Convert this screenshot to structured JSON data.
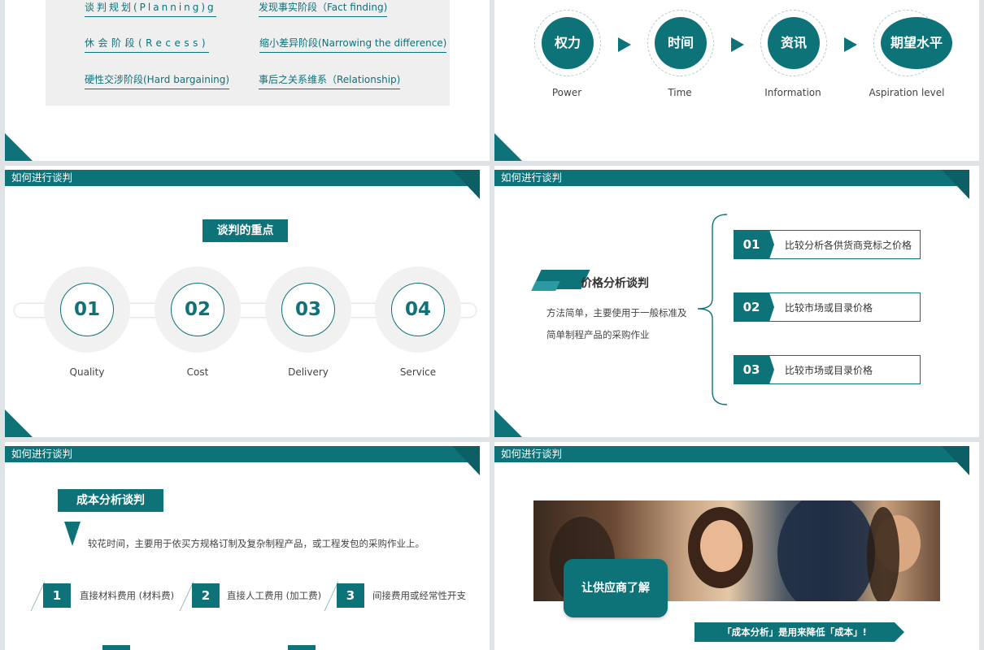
{
  "colors": {
    "accent": "#0e7279",
    "accent_dark": "#0d5f66"
  },
  "section_title": "如何进行谈判",
  "slide1": {
    "items": [
      "谈判规划(Planning)g",
      "发现事实阶段（Fact finding)",
      "休会阶段(Recess)",
      "缩小差异阶段(Narrowing the difference)",
      "硬性交涉阶段(Hard bargaining)",
      "事后之关系维系（Relationship)"
    ]
  },
  "slide2": {
    "factors": [
      {
        "cn": "权力",
        "en": "Power"
      },
      {
        "cn": "时间",
        "en": "Time"
      },
      {
        "cn": "资讯",
        "en": "Information"
      },
      {
        "cn": "期望水平",
        "en": "Aspiration level"
      }
    ]
  },
  "slide3": {
    "title": "谈判的重点",
    "points": [
      {
        "num": "01",
        "label": "Quality"
      },
      {
        "num": "02",
        "label": "Cost"
      },
      {
        "num": "03",
        "label": "Delivery"
      },
      {
        "num": "04",
        "label": "Service"
      }
    ]
  },
  "slide4": {
    "title": "价格分析谈判",
    "desc_line1": "方法简单，主要使用于一般标准及",
    "desc_line2": "简单制程产品的采购作业",
    "items": [
      {
        "num": "01",
        "text": "比较分析各供货商竞标之价格"
      },
      {
        "num": "02",
        "text": "比较市场或目录价格"
      },
      {
        "num": "03",
        "text": "比较市场或目录价格"
      }
    ]
  },
  "slide5": {
    "title": "成本分析谈判",
    "desc": "较花时间，主要用于依买方规格订制及复杂制程产品，或工程发包的采购作业上。",
    "items": [
      {
        "num": "1",
        "text": "直接材料费用 (材料费)"
      },
      {
        "num": "2",
        "text": "直接人工费用 (加工费)"
      },
      {
        "num": "3",
        "text": "间接费用或经常性开支"
      }
    ]
  },
  "slide6": {
    "badge": "让供应商了解",
    "banner": "「成本分析」是用来降低「成本」!"
  }
}
